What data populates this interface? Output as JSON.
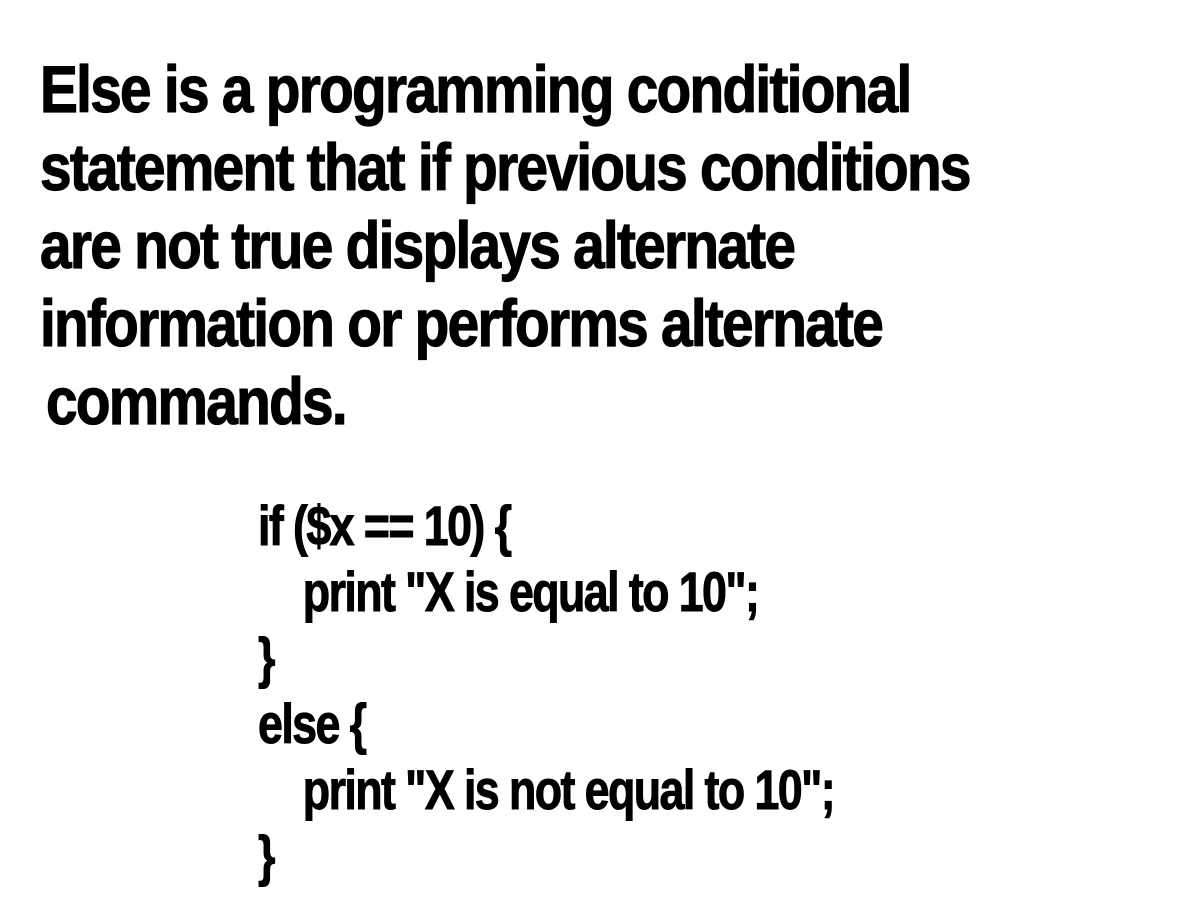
{
  "definition": {
    "lines": [
      "Else is a programming conditional",
      "statement that if previous conditions",
      "are not true displays alternate",
      "information or performs alternate",
      "commands."
    ]
  },
  "code": {
    "lines": [
      "if ($x == 10) {",
      "print \"X is equal to 10\";",
      "}",
      "else {",
      "print \"X is not equal to 10\";",
      "}"
    ]
  }
}
